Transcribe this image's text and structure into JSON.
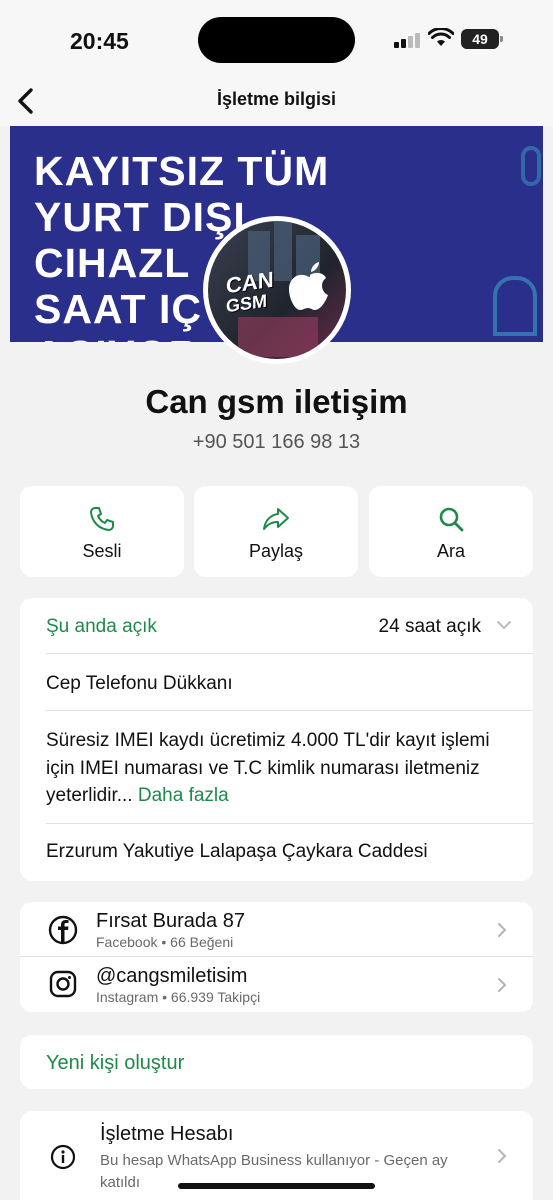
{
  "status": {
    "time": "20:45",
    "battery": "49"
  },
  "nav": {
    "title": "İşletme bilgisi"
  },
  "cover": {
    "lines": [
      "KAYITSIZ TÜM",
      "YURT DIŞI",
      "CIHAZL      ZI 1",
      "SAAT IÇ",
      "ACIYOR"
    ]
  },
  "avatar": {
    "logo_line1": "CAN",
    "logo_line2": "GSM"
  },
  "business": {
    "name": "Can gsm iletişim",
    "phone": "+90 501 166 98 13"
  },
  "actions": [
    {
      "label": "Sesli",
      "icon": "phone-icon"
    },
    {
      "label": "Paylaş",
      "icon": "share-icon"
    },
    {
      "label": "Ara",
      "icon": "search-icon"
    }
  ],
  "hours": {
    "status": "Şu anda açık",
    "value": "24 saat açık"
  },
  "category": "Cep Telefonu Dükkanı",
  "description": {
    "text": "Süresiz IMEI kaydı ücretimiz 4.000 TL'dir kayıt işlemi için IMEI numarası ve T.C kimlik numarası iletmeniz yeterlidir...",
    "more": "Daha fazla"
  },
  "address": "Erzurum Yakutiye Lalapaşa Çaykara Caddesi",
  "social": [
    {
      "name": "Fırsat Burada 87",
      "detail": "Facebook • 66 Beğeni",
      "icon": "facebook-icon"
    },
    {
      "name": "@cangsmiletisim",
      "detail": "Instagram • 66.939 Takipçi",
      "icon": "instagram-icon"
    }
  ],
  "create_contact": "Yeni kişi oluştur",
  "account": {
    "title": "İşletme Hesabı",
    "subtitle": "Bu hesap WhatsApp Business kullanıyor - Geçen ay katıldı"
  },
  "colors": {
    "accent": "#1e8a4a",
    "cover_bg": "#2b2f8c"
  }
}
